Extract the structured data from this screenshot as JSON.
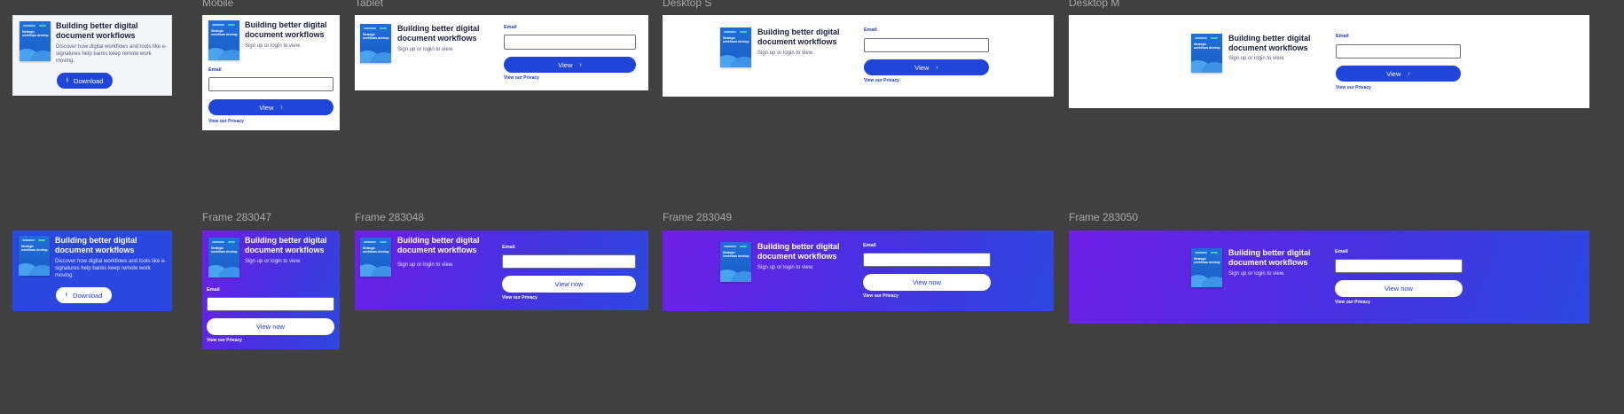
{
  "frames": {
    "mobile": "Mobile",
    "tablet": "Tablet",
    "desktop_s": "Desktop S",
    "desktop_m": "Desktop M",
    "f283047": "Frame 283047",
    "f283048": "Frame 283048",
    "f283049": "Frame 283049",
    "f283050": "Frame 283050"
  },
  "content": {
    "title": "Building better digital document workflows",
    "description": "Discover how digital workflows and tools like e-signatures help banks keep remote work moving.",
    "signup": "Sign up or login to view.",
    "email_label": "Email",
    "view_label": "View",
    "view_now_label": "View now",
    "download_label": "Download",
    "privacy": "View our Privacy",
    "cover_title": "Strategic workflows develop"
  },
  "icons": {
    "chevron": "chevron-right-icon",
    "download": "download-icon"
  },
  "colors": {
    "button_blue": "#1f46d8",
    "blue_bg": "#2a48de",
    "purple": "#6f1ee6",
    "canvas": "#404040"
  }
}
